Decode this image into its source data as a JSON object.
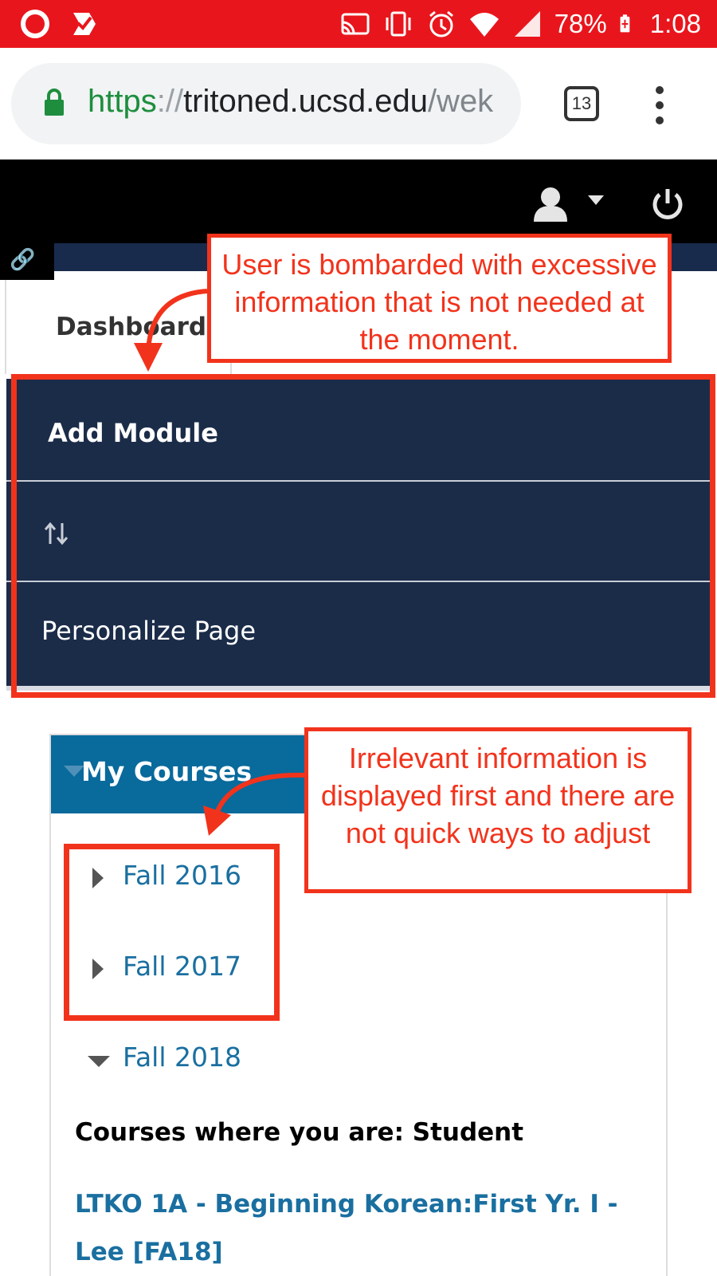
{
  "status_bar": {
    "battery": "78%",
    "time": "1:08"
  },
  "browser": {
    "url_scheme": "https",
    "url_sep": "://",
    "url_host": "tritoned.ucsd.edu",
    "url_path": "/wek",
    "tab_count": "13"
  },
  "site": {
    "dashboard_tab": "Dashboard"
  },
  "menu": {
    "add_module": "Add Module",
    "personalize": "Personalize Page"
  },
  "courses": {
    "title": "My Courses",
    "terms": [
      {
        "label": "Fall 2016",
        "expanded": false
      },
      {
        "label": "Fall 2017",
        "expanded": false
      },
      {
        "label": "Fall 2018",
        "expanded": true
      }
    ],
    "role_heading": "Courses where you are: Student",
    "course_link": "LTKO 1A - Beginning Korean:First Yr. I - Lee [FA18]"
  },
  "annotations": {
    "note1": "User is bombarded with excessive information that is not needed at the moment.",
    "note2": "Irrelevant information is displayed first and there are not quick ways to adjust"
  },
  "colors": {
    "status_bar": "#e8161c",
    "annotation_red": "#f2331c",
    "menu_panel": "#1b2c49",
    "courses_header": "#096a9c",
    "link_blue": "#1a6fa0"
  }
}
